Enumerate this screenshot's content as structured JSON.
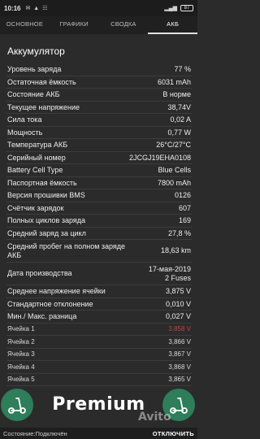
{
  "status_bar": {
    "time": "10:16",
    "battery": "87"
  },
  "tabs": [
    {
      "label": "ОСНОВНОЕ"
    },
    {
      "label": "ГРАФИКИ"
    },
    {
      "label": "СВОДКА"
    },
    {
      "label": "АКБ"
    }
  ],
  "active_tab": "АКБ",
  "section_title": "Аккумулятор",
  "rows": [
    {
      "label": "Уровень заряда",
      "value": "77 %"
    },
    {
      "label": "Остаточная ёмкость",
      "value": "6031 mAh"
    },
    {
      "label": "Состояние АКБ",
      "value": "В норме"
    },
    {
      "label": "Текущее напряжение",
      "value": "38,74V"
    },
    {
      "label": "Сила тока",
      "value": "0,02 A"
    },
    {
      "label": "Мощность",
      "value": "0,77 W"
    },
    {
      "label": "Температура АКБ",
      "value": "26°C/27°C"
    },
    {
      "label": "Серийный номер",
      "value": "2JCGJ19EHA0108"
    },
    {
      "label": "Battery Cell Type",
      "value": "Blue Cells"
    },
    {
      "label": "Паспортная ёмкость",
      "value": "7800 mAh"
    },
    {
      "label": "Версия прошивки BMS",
      "value": "0126"
    },
    {
      "label": "Счётчик зарядок",
      "value": "607"
    },
    {
      "label": "Полных циклов заряда",
      "value": "169"
    },
    {
      "label": "Средний заряд за цикл",
      "value": "27,8 %"
    },
    {
      "label": "Средний пробег на полном заряде АКБ",
      "value": "18,63 km"
    },
    {
      "label": "Дата производства",
      "value": "17-мая-2019\n2 Fuses"
    },
    {
      "label": "Среднее напряжение ячейки",
      "value": "3,875 V"
    },
    {
      "label": "Стандартное отклонение",
      "value": "0,010 V"
    },
    {
      "label": "Мин./ Макс. разница",
      "value": "0,027 V"
    }
  ],
  "cells": [
    {
      "label": "Ячейка 1",
      "value": "3,858 V",
      "status_color": "#b54a4a"
    },
    {
      "label": "Ячейка 2",
      "value": "3,866 V"
    },
    {
      "label": "Ячейка 3",
      "value": "3,867 V"
    },
    {
      "label": "Ячейка 4",
      "value": "3,868 V"
    },
    {
      "label": "Ячейка 5",
      "value": "3,865 V"
    }
  ],
  "premium_label": "Premium",
  "watermark": "Avito",
  "footer": {
    "state": "Состояние:Подключён",
    "disconnect_label": "ОТКЛЮЧИТЬ"
  },
  "colors": {
    "background": "#2b2b2b",
    "accent": "#2e7d5b",
    "warning": "#b54a4a"
  }
}
